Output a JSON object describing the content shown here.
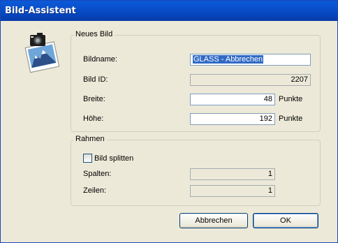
{
  "window": {
    "title": "Bild-Assistent"
  },
  "icon": {
    "name": "camera-photo-icon"
  },
  "neues_bild": {
    "legend": "Neues Bild",
    "bildname_label": "Bildname:",
    "bildname_value": "GLASS - Abbrechen",
    "bild_id_label": "Bild ID:",
    "bild_id_value": "2207",
    "breite_label": "Breite:",
    "breite_value": "48",
    "breite_unit": "Punkte",
    "hoehe_label": "Höhe:",
    "hoehe_value": "192",
    "hoehe_unit": "Punkte"
  },
  "rahmen": {
    "legend": "Rahmen",
    "split_label": "Bild splitten",
    "split_checked": false,
    "spalten_label": "Spalten:",
    "spalten_value": "1",
    "zeilen_label": "Zeilen:",
    "zeilen_value": "1"
  },
  "buttons": {
    "cancel": "Abbrechen",
    "ok": "OK"
  }
}
